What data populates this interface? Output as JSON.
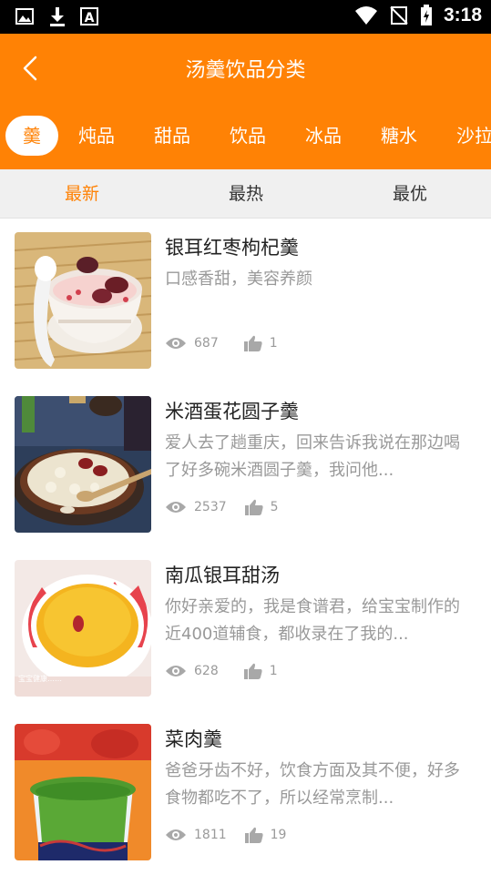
{
  "status_bar": {
    "time": "3:18",
    "left_icons": [
      "image-icon",
      "download-icon",
      "a-letter-icon"
    ],
    "right_icons": [
      "wifi-icon",
      "no-signal-icon",
      "battery-icon"
    ]
  },
  "header": {
    "title": "汤羹饮品分类",
    "accent_color": "#ff8205"
  },
  "categories": [
    "羹",
    "炖品",
    "甜品",
    "饮品",
    "冰品",
    "糖水",
    "沙拉"
  ],
  "active_category_index": 0,
  "sort_tabs": [
    "最新",
    "最热",
    "最优"
  ],
  "active_sort_index": 0,
  "items": [
    {
      "title": "银耳红枣枸杞羹",
      "desc": "口感香甜，美容养颜",
      "views": "687",
      "likes": "1"
    },
    {
      "title": "米酒蛋花圆子羹",
      "desc": "爱人去了趟重庆，回来告诉我说在那边喝了好多碗米酒圆子羹，我问他...",
      "views": "2537",
      "likes": "5"
    },
    {
      "title": "南瓜银耳甜汤",
      "desc": "你好亲爱的，我是食谱君，给宝宝制作的近400道辅食，都收录在了我的...",
      "views": "628",
      "likes": "1"
    },
    {
      "title": "菜肉羹",
      "desc": "爸爸牙齿不好，饮食方面及其不便，好多食物都吃不了，所以经常烹制...",
      "views": "1811",
      "likes": "19"
    }
  ]
}
